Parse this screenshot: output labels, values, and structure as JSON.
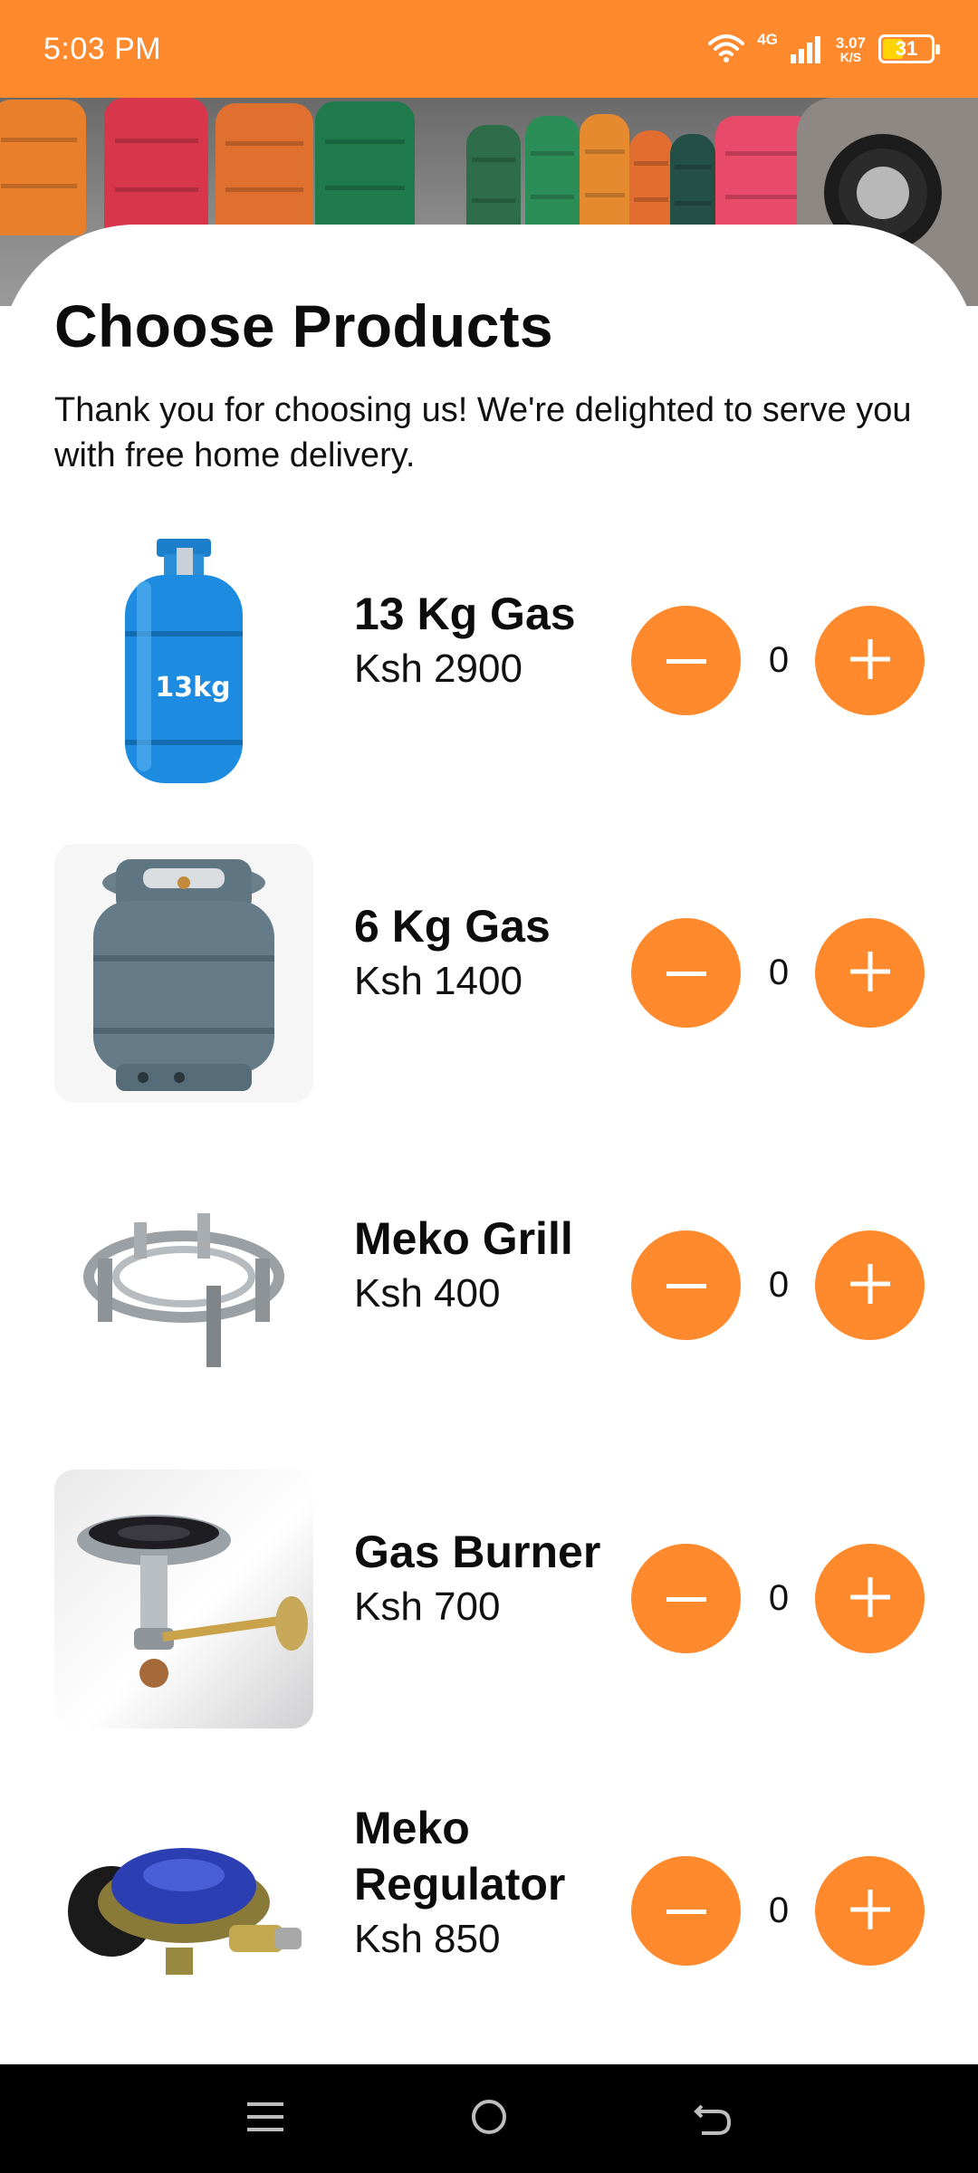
{
  "status_bar": {
    "time": "5:03 PM",
    "network": "4G",
    "speed_value": "3.07",
    "speed_unit": "K/S",
    "battery": "31",
    "colors": {
      "background": "#FF8A2E"
    }
  },
  "hero": {
    "image": "gas-cylinders-banner"
  },
  "page": {
    "title": "Choose Products",
    "subtitle": "Thank you for choosing us! We're delighted to serve you with free home delivery."
  },
  "products": [
    {
      "name": "13 Kg Gas",
      "price": "Ksh 2900",
      "quantity": "0",
      "image": "blue-13kg-cylinder",
      "label": "13kg"
    },
    {
      "name": "6 Kg Gas",
      "price": "Ksh 1400",
      "quantity": "0",
      "image": "grey-6kg-cylinder"
    },
    {
      "name": "Meko Grill",
      "price": "Ksh 400",
      "quantity": "0",
      "image": "metal-grill-stand"
    },
    {
      "name": "Gas Burner",
      "price": "Ksh 700",
      "quantity": "0",
      "image": "gas-burner"
    },
    {
      "name": "Meko Regulator",
      "price": "Ksh 850",
      "quantity": "0",
      "image": "gas-regulator"
    }
  ],
  "colors": {
    "accent": "#FF8A2E",
    "text": "#111111",
    "nav_bar": "#000000"
  },
  "nav_bar": {
    "icons": [
      "menu-icon",
      "home-icon",
      "back-icon"
    ]
  }
}
